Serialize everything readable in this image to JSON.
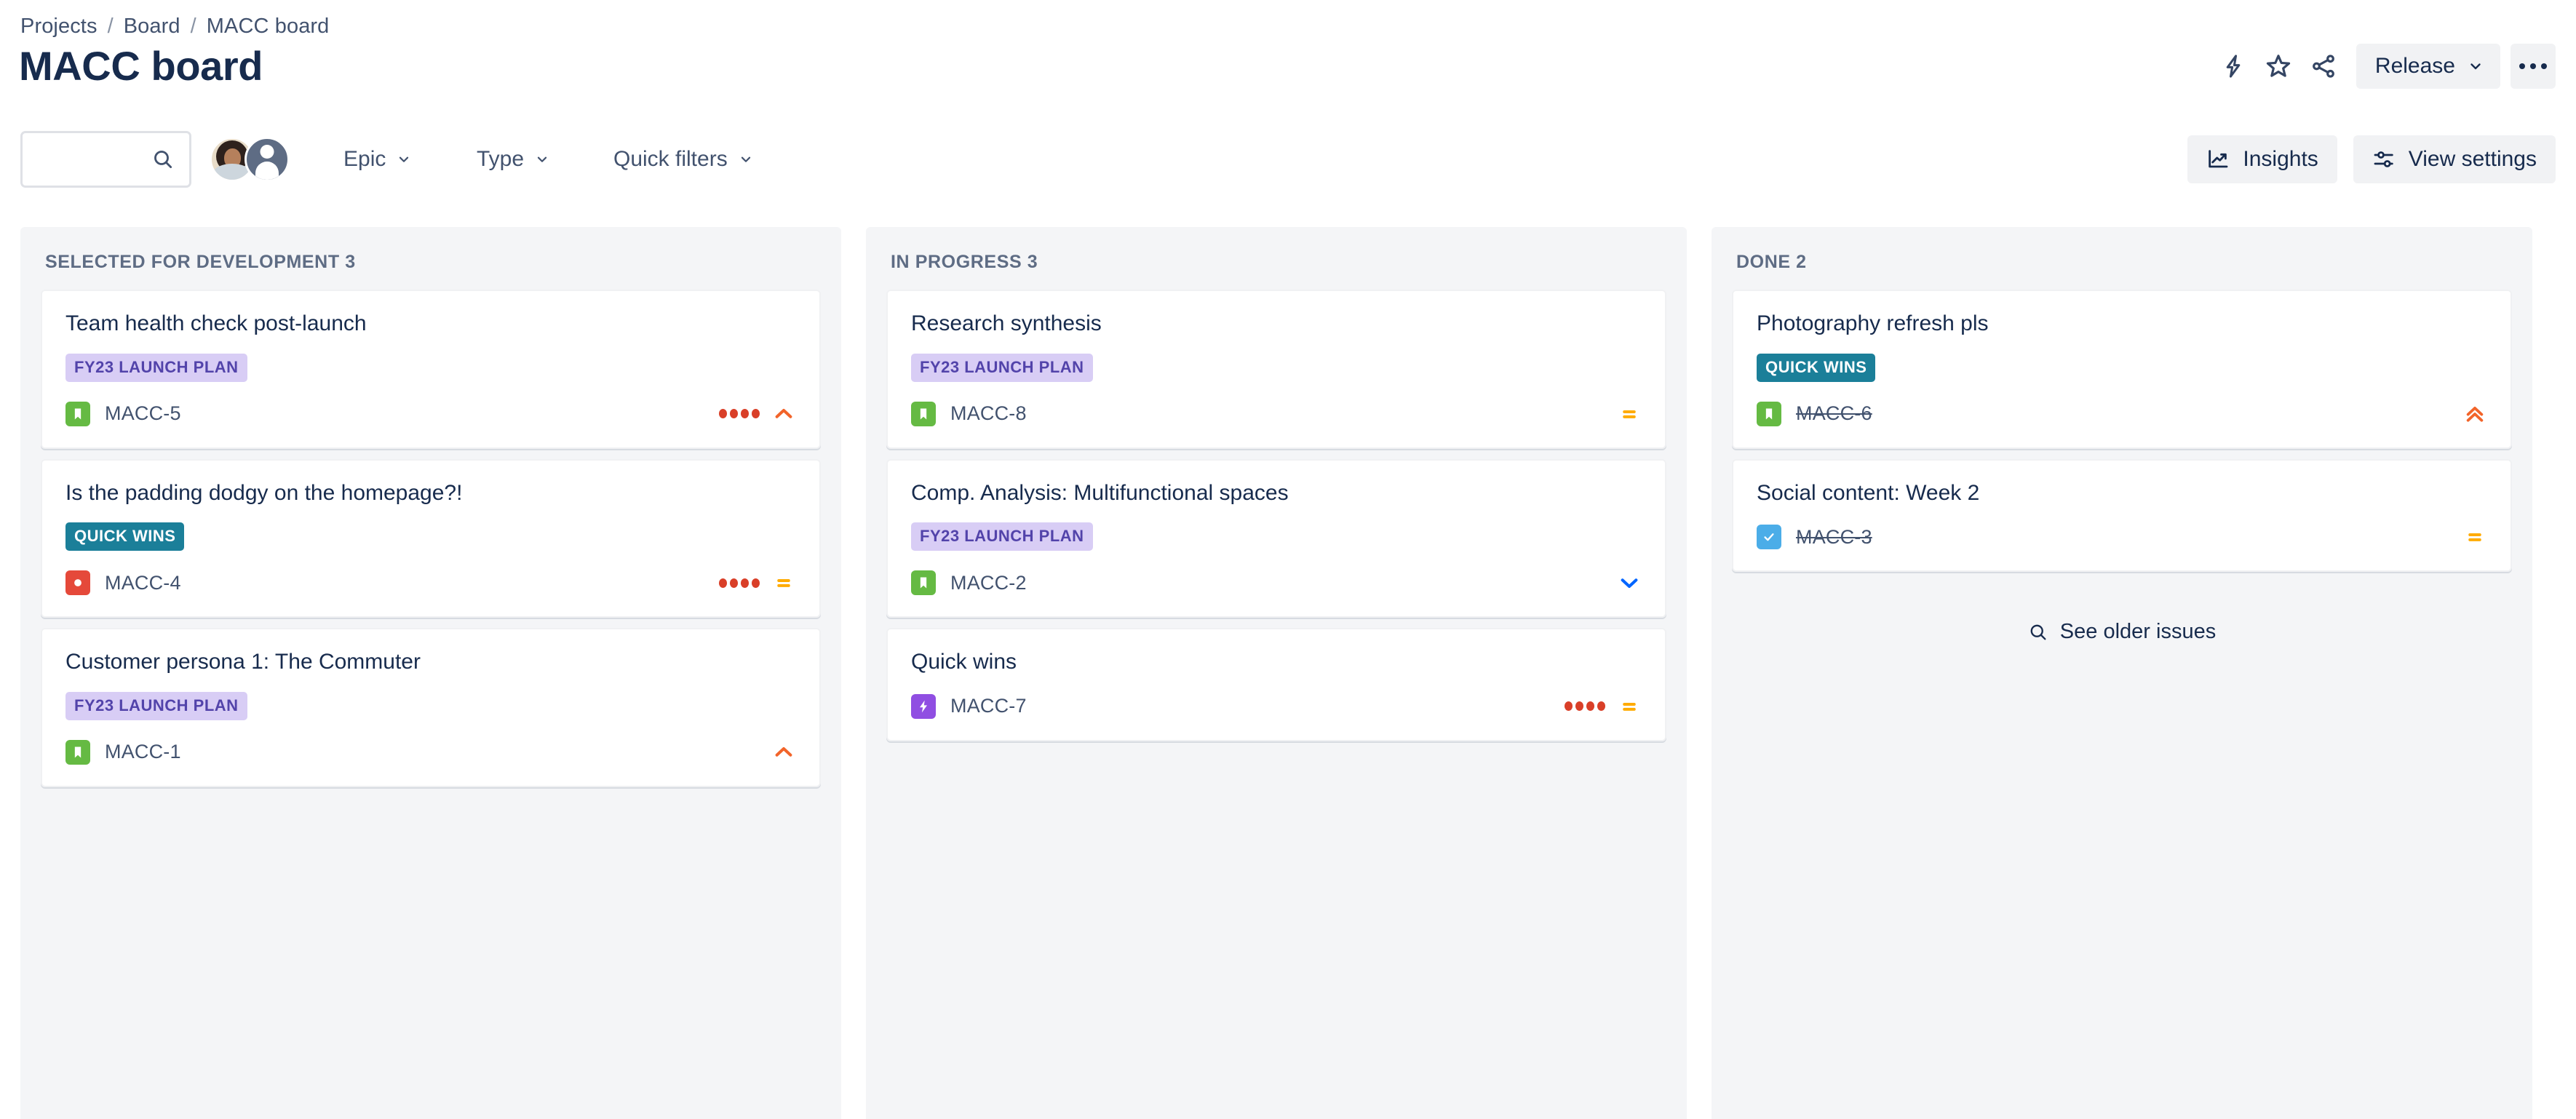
{
  "breadcrumb": {
    "items": [
      "Projects",
      "Board",
      "MACC board"
    ],
    "separator": "/"
  },
  "page_title": "MACC board",
  "header_actions": {
    "lightning_icon": "lightning-icon",
    "star_icon": "star-icon",
    "share_icon": "share-icon",
    "release_label": "Release",
    "more_label": "more-actions"
  },
  "filter_bar": {
    "search_value": "",
    "search_placeholder": "",
    "search_icon": "search-icon",
    "avatars": [
      {
        "name": "user-avatar-photo",
        "type": "photo"
      },
      {
        "name": "user-avatar-default",
        "type": "silhouette"
      }
    ],
    "dropdowns": [
      {
        "label": "Epic",
        "name": "epic-filter"
      },
      {
        "label": "Type",
        "name": "type-filter"
      },
      {
        "label": "Quick filters",
        "name": "quick-filters"
      }
    ],
    "insights_label": "Insights",
    "view_settings_label": "View settings"
  },
  "colors": {
    "story": "#65ba43",
    "bug": "#e5493a",
    "task": "#4bade8",
    "epic": "#904ee2",
    "epic_tag_purple_bg": "#d8cdf5",
    "epic_tag_purple_text": "#5243aa",
    "epic_tag_teal_bg": "#1b7f99",
    "priority_high": "#f2642a",
    "priority_highest": "#f2642a",
    "priority_medium": "#ffab00",
    "priority_low": "#0065ff",
    "story_point_dot": "#d93f28",
    "column_bg": "#f4f5f7"
  },
  "columns": [
    {
      "name": "column-selected-for-development",
      "title": "SELECTED FOR DEVELOPMENT",
      "count": "3",
      "header": "SELECTED FOR DEVELOPMENT 3",
      "cards": [
        {
          "title": "Team health check post-launch",
          "epic_tag": "FY23 LAUNCH PLAN",
          "epic_tag_style": "purple",
          "key": "MACC-5",
          "type": "story",
          "type_icon": "story-icon",
          "dots": 4,
          "priority": "high",
          "priority_icon": "chevron-up-icon",
          "done": false
        },
        {
          "title": "Is the padding dodgy on the homepage?!",
          "epic_tag": "QUICK WINS",
          "epic_tag_style": "teal",
          "key": "MACC-4",
          "type": "bug",
          "type_icon": "bug-icon",
          "dots": 4,
          "priority": "medium",
          "priority_icon": "equals-icon",
          "done": false
        },
        {
          "title": "Customer persona 1: The Commuter",
          "epic_tag": "FY23 LAUNCH PLAN",
          "epic_tag_style": "purple",
          "key": "MACC-1",
          "type": "story",
          "type_icon": "story-icon",
          "dots": 0,
          "priority": "high",
          "priority_icon": "chevron-up-icon",
          "done": false
        }
      ],
      "see_older": null
    },
    {
      "name": "column-in-progress",
      "title": "IN PROGRESS",
      "count": "3",
      "header": "IN PROGRESS 3",
      "cards": [
        {
          "title": "Research synthesis",
          "epic_tag": "FY23 LAUNCH PLAN",
          "epic_tag_style": "purple",
          "key": "MACC-8",
          "type": "story",
          "type_icon": "story-icon",
          "dots": 0,
          "priority": "medium",
          "priority_icon": "equals-icon",
          "done": false
        },
        {
          "title": "Comp. Analysis: Multifunctional spaces",
          "epic_tag": "FY23 LAUNCH PLAN",
          "epic_tag_style": "purple",
          "key": "MACC-2",
          "type": "story",
          "type_icon": "story-icon",
          "dots": 0,
          "priority": "low",
          "priority_icon": "chevron-down-icon",
          "done": false
        },
        {
          "title": "Quick wins",
          "epic_tag": null,
          "epic_tag_style": null,
          "key": "MACC-7",
          "type": "epic",
          "type_icon": "epic-icon",
          "dots": 4,
          "priority": "medium",
          "priority_icon": "equals-icon",
          "done": false
        }
      ],
      "see_older": null
    },
    {
      "name": "column-done",
      "title": "DONE",
      "count": "2",
      "header": "DONE 2",
      "cards": [
        {
          "title": "Photography refresh pls",
          "epic_tag": "QUICK WINS",
          "epic_tag_style": "teal",
          "key": "MACC-6",
          "type": "story",
          "type_icon": "story-icon",
          "dots": 0,
          "priority": "highest",
          "priority_icon": "double-chevron-up-icon",
          "done": true
        },
        {
          "title": "Social content: Week 2",
          "epic_tag": null,
          "epic_tag_style": null,
          "key": "MACC-3",
          "type": "task",
          "type_icon": "task-icon",
          "dots": 0,
          "priority": "medium",
          "priority_icon": "equals-icon",
          "done": true
        }
      ],
      "see_older": "See older issues"
    }
  ]
}
